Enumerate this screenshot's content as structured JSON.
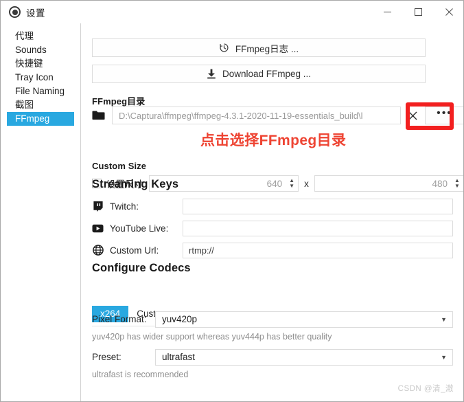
{
  "window": {
    "title": "设置",
    "icon": "record-circle-icon",
    "controls": {
      "minimize": "minimize-icon",
      "maximize": "maximize-icon",
      "close": "close-icon"
    }
  },
  "sidebar": {
    "items": [
      {
        "label": "代理",
        "selected": false
      },
      {
        "label": "Sounds",
        "selected": false
      },
      {
        "label": "快捷键",
        "selected": false
      },
      {
        "label": "Tray Icon",
        "selected": false
      },
      {
        "label": "File Naming",
        "selected": false
      },
      {
        "label": "截图",
        "selected": false
      },
      {
        "label": "FFmpeg",
        "selected": true
      }
    ]
  },
  "main": {
    "log_button": "FFmpeg日志 ...",
    "download_button": "Download FFmpeg ...",
    "ffmpeg_folder": {
      "heading": "FFmpeg目录",
      "path_value": "D:\\Captura\\ffmpeg\\ffmpeg-4.3.1-2020-11-19-essentials_build\\l",
      "clear_label": "✕",
      "browse_label": "•••"
    },
    "custom_size": {
      "heading": "Custom Size",
      "checkbox_label": "设置尺寸",
      "width_value": "640",
      "separator": "x",
      "height_value": "480"
    },
    "streaming_keys": {
      "heading": "Streaming Keys",
      "rows": [
        {
          "icon": "twitch-icon",
          "label": "Twitch:",
          "value": ""
        },
        {
          "icon": "youtube-icon",
          "label": "YouTube Live:",
          "value": ""
        },
        {
          "icon": "globe-icon",
          "label": "Custom Url:",
          "value": "rtmp://"
        }
      ]
    },
    "configure_codecs": {
      "heading": "Configure Codecs",
      "tabs": [
        {
          "label": "x264",
          "active": true
        },
        {
          "label": "Custom",
          "active": false
        }
      ],
      "pixel_format": {
        "label": "Pixel Format:",
        "value": "yuv420p",
        "hint": "yuv420p has wider support whereas yuv444p has better quality"
      },
      "preset": {
        "label": "Preset:",
        "value": "ultrafast",
        "hint": "ultrafast is recommended"
      }
    }
  },
  "annotation": {
    "text": "点击选择FFmpeg目录",
    "color": "#ee4433",
    "box_color": "#f21f1f"
  },
  "watermark": "CSDN @清_澈",
  "colors": {
    "accent": "#29a8e0",
    "text": "#1f1f1f",
    "border": "#dcdcdc",
    "hint": "#8e8e8e"
  }
}
